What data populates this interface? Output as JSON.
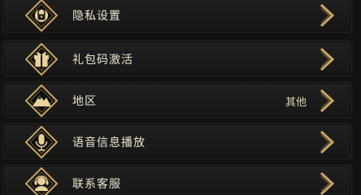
{
  "menu": {
    "items": [
      {
        "label": "隐私设置",
        "icon": "lock-icon",
        "value": ""
      },
      {
        "label": "礼包码激活",
        "icon": "gift-icon",
        "value": ""
      },
      {
        "label": "地区",
        "icon": "mountain-icon",
        "value": "其他"
      },
      {
        "label": "语音信息播放",
        "icon": "microphone-icon",
        "value": ""
      },
      {
        "label": "联系客服",
        "icon": "headset-icon",
        "value": ""
      }
    ]
  },
  "colors": {
    "gold": "#c8a564",
    "gold_light": "#e9d39c",
    "text": "#ece4cf"
  }
}
